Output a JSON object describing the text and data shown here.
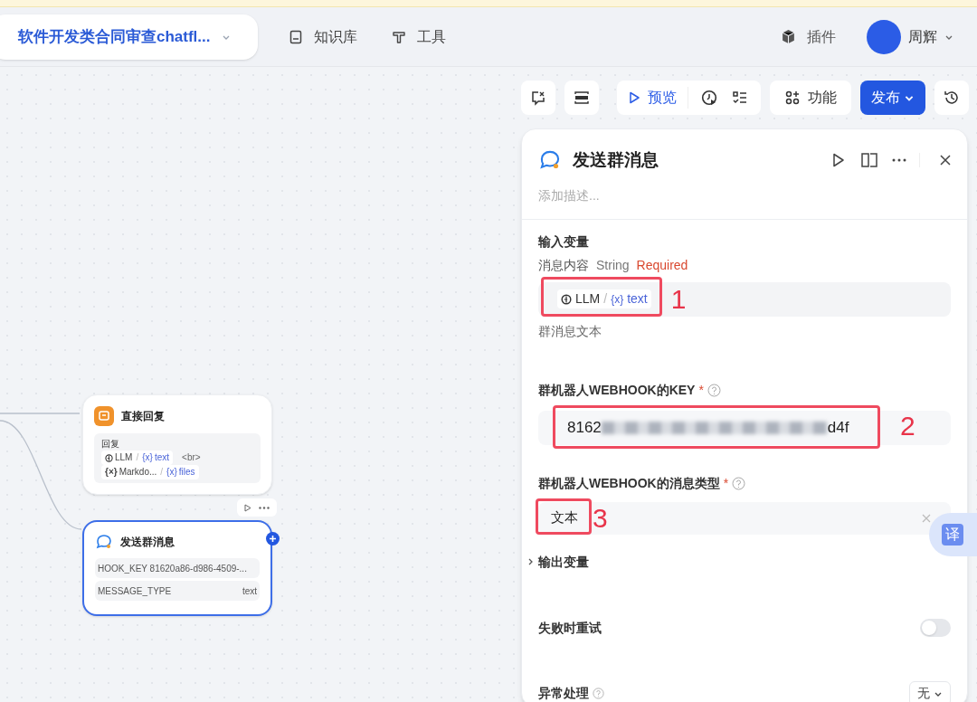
{
  "header": {
    "app_title": "软件开发类合同审查chatfl...",
    "nav": [
      {
        "label": "知识库",
        "kind": "book"
      },
      {
        "label": "工具",
        "kind": "tool"
      }
    ],
    "plugins": "插件",
    "user": "周辉"
  },
  "toolbar": {
    "preview": "预览",
    "features": "功能",
    "publish": "发布"
  },
  "canvas": {
    "nodes": [
      {
        "title": "直接回复",
        "kind": "answer",
        "selected": false,
        "section": "回复",
        "lines": [
          [
            {
              "kind": "llm",
              "text": "LLM"
            },
            {
              "kind": "var",
              "sep": "/",
              "icon": "{x}",
              "text": "text"
            },
            {
              "kind": "plain",
              "text": "<br>"
            }
          ],
          [
            {
              "kind": "varnode",
              "icon": "{×}",
              "text": "Markdo..."
            },
            {
              "kind": "var",
              "sep": "/",
              "icon": "{x}",
              "text": "files"
            }
          ]
        ]
      },
      {
        "title": "发送群消息",
        "kind": "message",
        "selected": true,
        "params": [
          {
            "name": "HOOK_KEY 81620a86-d986-4509-..."
          },
          {
            "name": "MESSAGE_TYPE",
            "value": "text"
          }
        ]
      }
    ]
  },
  "panel": {
    "title": "发送群消息",
    "description_placeholder": "添加描述...",
    "input_section": "输入变量",
    "content_field": {
      "label": "消息内容",
      "type": "String",
      "required": "Required",
      "source": "LLM",
      "sep": "/",
      "variable_icon": "{x}",
      "variable": "text",
      "hint": "群消息文本",
      "annotation": "1"
    },
    "key_field": {
      "label": "群机器人WEBHOOK的KEY",
      "required_mark": "*",
      "value_start": "8162",
      "value_end": "d4f",
      "annotation": "2"
    },
    "type_field": {
      "label": "群机器人WEBHOOK的消息类型",
      "required_mark": "*",
      "value": "文本",
      "annotation": "3"
    },
    "output_section": "输出变量",
    "output_expanded": false,
    "retry": {
      "label": "失败时重试",
      "on": false
    },
    "error_handling": {
      "label": "异常处理",
      "value": "无"
    }
  },
  "translate_button": "译"
}
